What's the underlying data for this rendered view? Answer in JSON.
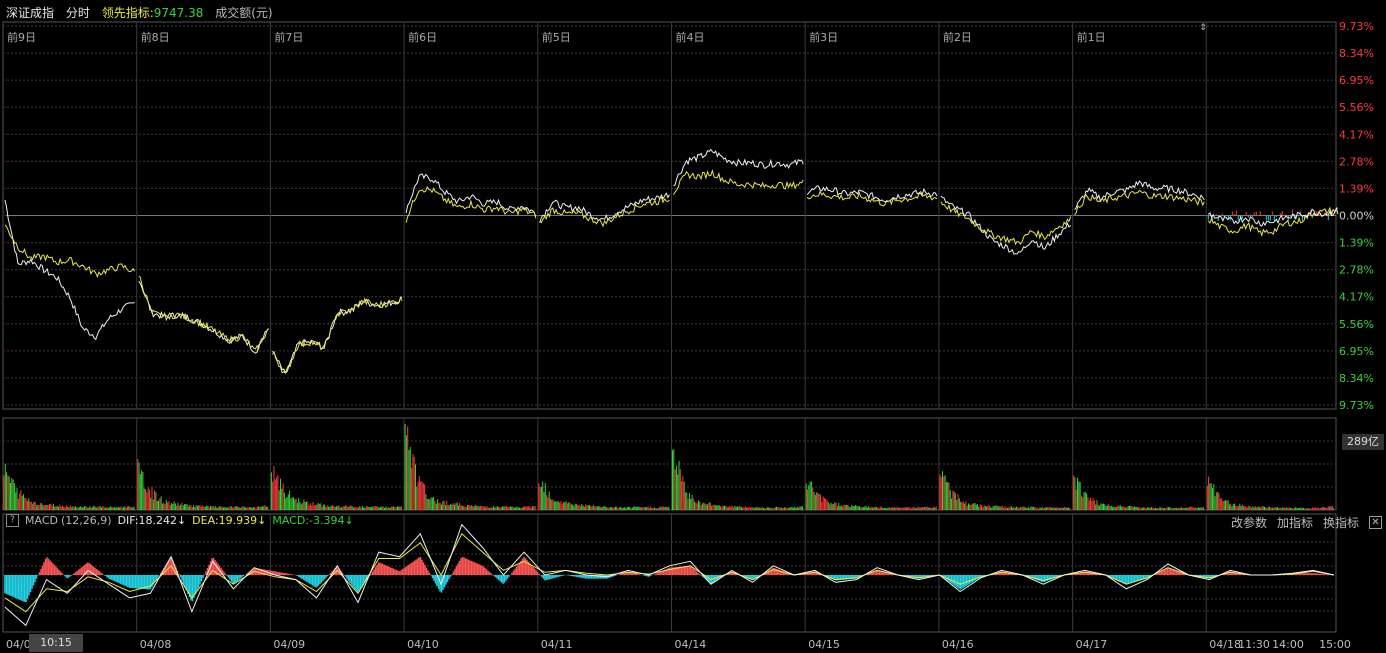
{
  "header": {
    "index_name": "深证成指",
    "mode": "分时",
    "leading_label": "领先指标:",
    "leading_value": "9747.38",
    "turnover_label": "成交额(元)"
  },
  "chart_data": {
    "type": "line",
    "y_tick_labels_right": [
      "9.73%",
      "8.34%",
      "6.95%",
      "5.56%",
      "4.17%",
      "2.78%",
      "1.39%",
      "0.00%",
      "1.39%",
      "2.78%",
      "4.17%",
      "5.56%",
      "6.95%",
      "8.34%",
      "9.73%"
    ],
    "day_labels_top": [
      "前9日",
      "前8日",
      "前7日",
      "前6日",
      "前5日",
      "前4日",
      "前3日",
      "前2日",
      "前1日"
    ],
    "date_labels_bottom": [
      "04/0",
      "04/08",
      "04/09",
      "04/10",
      "04/11",
      "04/14",
      "04/15",
      "04/16",
      "04/17",
      "04/18"
    ],
    "bottom_time_ticks": [
      "11:30",
      "14:00",
      "15:00"
    ],
    "ylim": [
      -9.73,
      9.73
    ],
    "price_series": [
      {
        "name": "white",
        "color": "#f0f0f0",
        "days": [
          [
            0.8,
            -2.5,
            -2.3,
            -2.8,
            -3.2,
            -4.2,
            -5.8,
            -6.2,
            -5.3,
            -4.8,
            -4.5
          ],
          [
            -3.2,
            -5.0,
            -5.2,
            -5.1,
            -5.3,
            -5.6,
            -6.0,
            -6.4,
            -6.2,
            -7.0,
            -5.8
          ],
          [
            -7.0,
            -8.2,
            -6.6,
            -6.5,
            -6.8,
            -5.0,
            -4.9,
            -4.4,
            -4.6,
            -4.5,
            -4.3
          ],
          [
            0.3,
            2.0,
            1.9,
            1.2,
            0.7,
            1.0,
            0.6,
            0.7,
            0.3,
            0.5,
            0.1
          ],
          [
            -0.2,
            0.7,
            0.4,
            0.4,
            0.0,
            -0.2,
            0.2,
            0.5,
            0.8,
            0.9,
            1.1
          ],
          [
            1.6,
            2.8,
            3.0,
            3.3,
            2.9,
            2.7,
            2.7,
            2.6,
            2.7,
            2.6,
            2.8
          ],
          [
            1.2,
            1.4,
            1.3,
            1.1,
            1.2,
            1.0,
            0.8,
            1.0,
            1.1,
            1.2,
            1.1
          ],
          [
            0.9,
            0.4,
            0.1,
            -0.6,
            -1.3,
            -1.6,
            -2.0,
            -1.2,
            -1.7,
            -1.0,
            -0.4
          ],
          [
            0.3,
            1.3,
            0.9,
            1.2,
            1.3,
            1.7,
            1.4,
            1.4,
            1.3,
            1.1,
            0.9
          ]
        ]
      },
      {
        "name": "yellow",
        "color": "#e8e84a",
        "days": [
          [
            -0.5,
            -1.6,
            -2.2,
            -2.1,
            -2.4,
            -2.3,
            -2.6,
            -3.0,
            -2.8,
            -2.6,
            -2.9
          ],
          [
            -3.0,
            -5.0,
            -5.2,
            -5.1,
            -5.3,
            -5.6,
            -6.0,
            -6.4,
            -6.2,
            -7.0,
            -5.8
          ],
          [
            -7.0,
            -8.2,
            -6.6,
            -6.5,
            -6.8,
            -5.0,
            -4.9,
            -4.4,
            -4.6,
            -4.5,
            -4.3
          ],
          [
            -0.2,
            1.4,
            1.3,
            0.8,
            0.4,
            0.6,
            0.3,
            0.4,
            0.1,
            0.3,
            0.0
          ],
          [
            -0.4,
            0.3,
            0.1,
            0.1,
            -0.2,
            -0.4,
            0.0,
            0.3,
            0.6,
            0.7,
            0.9
          ],
          [
            1.2,
            2.1,
            2.0,
            2.2,
            1.8,
            1.6,
            1.6,
            1.5,
            1.6,
            1.5,
            1.7
          ],
          [
            1.0,
            1.1,
            1.0,
            0.9,
            1.0,
            0.8,
            0.6,
            0.8,
            0.9,
            1.0,
            0.9
          ],
          [
            0.7,
            0.2,
            -0.1,
            -0.6,
            -1.0,
            -1.2,
            -1.4,
            -0.8,
            -1.1,
            -0.6,
            -0.2
          ],
          [
            0.2,
            1.0,
            0.7,
            0.9,
            1.0,
            1.2,
            1.0,
            1.0,
            0.9,
            0.8,
            0.6
          ]
        ]
      }
    ],
    "volume_unit_label": "289亿",
    "volume_ylim": [
      0,
      289
    ],
    "volume_days": [
      [
        160,
        70,
        35,
        22,
        18,
        15,
        12,
        14,
        10,
        12,
        15
      ],
      [
        150,
        70,
        32,
        24,
        18,
        14,
        12,
        11,
        12,
        10,
        16
      ],
      [
        150,
        70,
        38,
        25,
        18,
        14,
        14,
        12,
        12,
        11,
        15
      ],
      [
        289,
        110,
        40,
        30,
        22,
        16,
        14,
        12,
        12,
        11,
        14
      ],
      [
        140,
        45,
        28,
        20,
        15,
        12,
        10,
        10,
        11,
        10,
        13
      ],
      [
        230,
        70,
        30,
        22,
        16,
        12,
        11,
        10,
        10,
        10,
        12
      ],
      [
        120,
        50,
        26,
        18,
        14,
        12,
        10,
        10,
        9,
        10,
        12
      ],
      [
        150,
        60,
        26,
        18,
        14,
        12,
        10,
        10,
        9,
        10,
        12
      ],
      [
        130,
        50,
        24,
        16,
        13,
        11,
        10,
        9,
        9,
        10,
        11
      ],
      [
        110,
        45,
        22,
        15,
        12,
        10,
        9,
        9,
        8,
        10,
        12
      ]
    ],
    "macd": {
      "label": "MACD",
      "params": "(12,26,9)",
      "dif_label": "DIF:18.242↓",
      "dea_label": "DEA:19.939↓",
      "macd_label": "MACD:-3.394↓",
      "ylim": [
        -60,
        60
      ],
      "dif": [
        -35,
        -55,
        -5,
        -20,
        5,
        -10,
        -25,
        -20,
        20,
        -40,
        15,
        -15,
        8,
        0,
        -5,
        -25,
        10,
        -30,
        25,
        20,
        45,
        -10,
        55,
        30,
        0,
        25,
        0,
        5,
        0,
        -2,
        5,
        0,
        10,
        15,
        -10,
        5,
        -8,
        10,
        0,
        5,
        -8,
        -5,
        8,
        0,
        -5,
        0,
        -18,
        -3,
        5,
        0,
        -10,
        0,
        5,
        0,
        -15,
        -5,
        12,
        0,
        -5,
        5,
        0,
        0,
        2,
        5,
        0
      ],
      "dea": [
        -25,
        -40,
        -15,
        -18,
        -2,
        -8,
        -18,
        -12,
        10,
        -25,
        5,
        -10,
        4,
        -2,
        -5,
        -18,
        5,
        -20,
        18,
        18,
        35,
        0,
        45,
        25,
        5,
        15,
        3,
        5,
        2,
        0,
        3,
        1,
        6,
        10,
        -5,
        3,
        -5,
        6,
        0,
        3,
        -5,
        -3,
        5,
        0,
        -3,
        0,
        -10,
        -2,
        3,
        0,
        -6,
        0,
        3,
        0,
        -10,
        -3,
        8,
        0,
        -3,
        3,
        0,
        0,
        1,
        4,
        0
      ]
    },
    "grid": true
  },
  "buttons": {
    "help": "?",
    "change_params": "改参数",
    "add_indicator": "加指标",
    "switch_indicator": "换指标",
    "close": "✕"
  },
  "time_cursor": "10:15",
  "colors": {
    "up": "#ff3b3b",
    "down": "#39d239",
    "flat": "#d0d0d0",
    "macd_pos": "#ff5555",
    "macd_neg": "#22d3e6",
    "grid": "#3a3a3a",
    "divider": "#7a0000"
  }
}
